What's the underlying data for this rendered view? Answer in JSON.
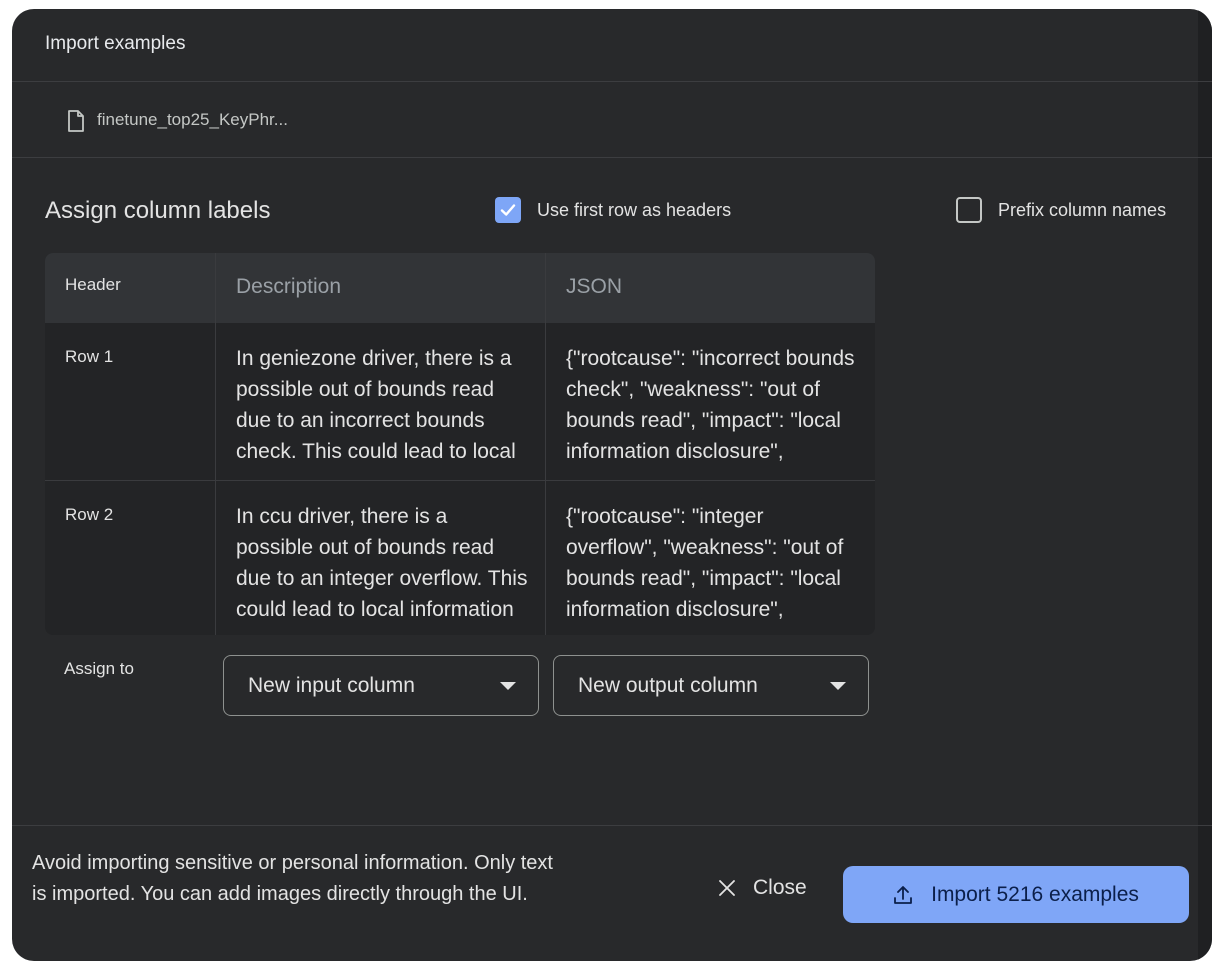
{
  "dialog": {
    "title": "Import examples",
    "file_name": "finetune_top25_KeyPhr..."
  },
  "section": {
    "title": "Assign column labels",
    "use_first_row_label": "Use first row as headers",
    "use_first_row_checked": true,
    "prefix_label": "Prefix column names",
    "prefix_checked": false
  },
  "table": {
    "columns": [
      "Header",
      "Description",
      "JSON"
    ],
    "rows": [
      {
        "label": "Row 1",
        "description": "In geniezone driver, there is a possible out of bounds read due to an incorrect bounds check. This could lead to local information",
        "json": "{\"rootcause\": \"incorrect bounds check\", \"weakness\": \"out of bounds read\", \"impact\": \"local information disclosure\", \"vector\": \"\"}"
      },
      {
        "label": "Row 2",
        "description": "In ccu driver, there is a possible out of bounds read due to an integer overflow. This could lead to local information disclosure with",
        "json": "{\"rootcause\": \"integer overflow\", \"weakness\": \"out of bounds read\", \"impact\": \"local information disclosure\", \"vector\": \"\"}"
      }
    ]
  },
  "assign": {
    "label": "Assign to",
    "input_value": "New input column",
    "output_value": "New output column"
  },
  "footer": {
    "note": "Avoid importing sensitive or personal information. Only text is imported. You can add images directly through the UI.",
    "close_label": "Close",
    "import_label": "Import 5216 examples"
  },
  "colors": {
    "dialog_bg": "#28292b",
    "accent": "#7fa6f7",
    "text": "#e3e3e3"
  },
  "icons": [
    "file-icon",
    "check-icon",
    "close-icon",
    "upload-icon",
    "chevron-down-icon"
  ]
}
